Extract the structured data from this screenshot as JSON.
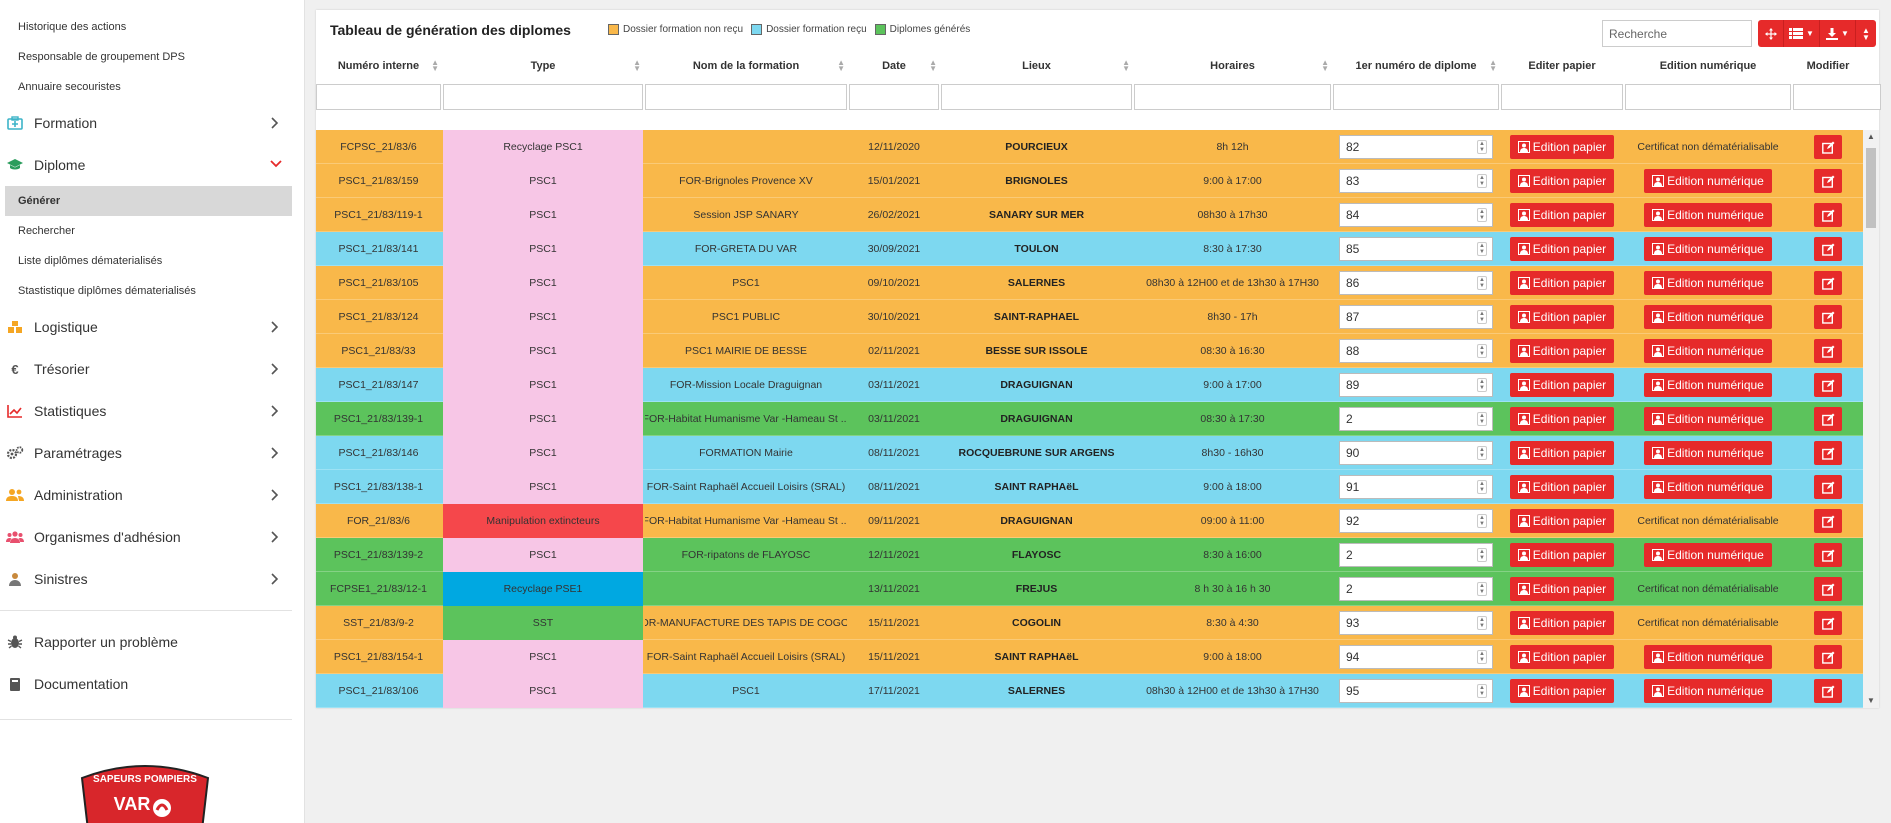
{
  "sidebar": {
    "subitems_top": [
      "Historique des actions",
      "Responsable de groupement DPS",
      "Annuaire secouristes"
    ],
    "menu_formation": {
      "label": "Formation",
      "color": "#3cb4c8"
    },
    "menu_diplome": {
      "label": "Diplome",
      "color": "#2a9d5c"
    },
    "diplome_subitems": [
      "Générer",
      "Rechercher",
      "Liste diplômes dématerialisés",
      "Stastistique diplômes dématerialisés"
    ],
    "menu_items": [
      {
        "label": "Logistique",
        "icon": "cubes-icon",
        "color": "#f5a623"
      },
      {
        "label": "Trésorier",
        "icon": "euro-icon",
        "color": "#555555"
      },
      {
        "label": "Statistiques",
        "icon": "chart-icon",
        "color": "#e62a2a"
      },
      {
        "label": "Paramétrages",
        "icon": "cogs-icon",
        "color": "#555555"
      },
      {
        "label": "Administration",
        "icon": "users-icon",
        "color": "#f5a623"
      },
      {
        "label": "Organismes d'adhésion",
        "icon": "group-icon",
        "color": "#e8506e"
      },
      {
        "label": "Sinistres",
        "icon": "person-icon",
        "color": "#c8893c"
      }
    ],
    "report_problem": "Rapporter un problème",
    "documentation": "Documentation",
    "logo_text_top": "SAPEURS POMPIERS",
    "logo_text_var": "VAR"
  },
  "panel": {
    "title": "Tableau de génération des diplomes",
    "legend": [
      {
        "label": "Dossier formation non reçu",
        "color": "#f9b84a"
      },
      {
        "label": "Dossier formation reçu",
        "color": "#7dd8f0"
      },
      {
        "label": "Diplomes générés",
        "color": "#5cc35c"
      }
    ],
    "search_placeholder": "Recherche"
  },
  "columns": [
    "Numéro interne",
    "Type",
    "Nom de la formation",
    "Date",
    "Lieux",
    "Horaires",
    "1er numéro de diplome",
    "Editer papier",
    "Edition numérique",
    "Modifier"
  ],
  "labels": {
    "edition_papier": "Edition papier",
    "edition_numerique": "Edition numérique",
    "certificat": "Certificat non dématérialisable"
  },
  "colors": {
    "orange": "#f9b84a",
    "blue": "#7dd8f0",
    "green": "#5cc35c",
    "pink": "#f7c6e6",
    "red_type": "#f5474b",
    "blue_type": "#00a8e1",
    "green_type": "#5cc35c",
    "accent": "#e62a2a"
  },
  "rows": [
    {
      "num": "FCPSC_21/83/6",
      "type": "Recyclage PSC1",
      "nom": "",
      "date": "12/11/2020",
      "lieu": "POURCIEUX",
      "horaires": "8h 12h",
      "diplome": "82",
      "status": "orange",
      "type_color": "pink",
      "numerique": false
    },
    {
      "num": "PSC1_21/83/159",
      "type": "PSC1",
      "nom": "FOR-Brignoles Provence XV",
      "date": "15/01/2021",
      "lieu": "BRIGNOLES",
      "horaires": "9:00 à 17:00",
      "diplome": "83",
      "status": "orange",
      "type_color": "pink",
      "numerique": true
    },
    {
      "num": "PSC1_21/83/119-1",
      "type": "PSC1",
      "nom": "Session JSP SANARY",
      "date": "26/02/2021",
      "lieu": "SANARY SUR MER",
      "horaires": "08h30 à 17h30",
      "diplome": "84",
      "status": "orange",
      "type_color": "pink",
      "numerique": true
    },
    {
      "num": "PSC1_21/83/141",
      "type": "PSC1",
      "nom": "FOR-GRETA DU VAR",
      "date": "30/09/2021",
      "lieu": "TOULON",
      "horaires": "8:30 à 17:30",
      "diplome": "85",
      "status": "blue",
      "type_color": "pink",
      "numerique": true
    },
    {
      "num": "PSC1_21/83/105",
      "type": "PSC1",
      "nom": "PSC1",
      "date": "09/10/2021",
      "lieu": "SALERNES",
      "horaires": "08h30 à 12H00 et de 13h30 à 17H30",
      "diplome": "86",
      "status": "orange",
      "type_color": "pink",
      "numerique": true
    },
    {
      "num": "PSC1_21/83/124",
      "type": "PSC1",
      "nom": "PSC1 PUBLIC",
      "date": "30/10/2021",
      "lieu": "SAINT-RAPHAEL",
      "horaires": "8h30 - 17h",
      "diplome": "87",
      "status": "orange",
      "type_color": "pink",
      "numerique": true
    },
    {
      "num": "PSC1_21/83/33",
      "type": "PSC1",
      "nom": "PSC1 MAIRIE DE BESSE",
      "date": "02/11/2021",
      "lieu": "BESSE SUR ISSOLE",
      "horaires": "08:30 à 16:30",
      "diplome": "88",
      "status": "orange",
      "type_color": "pink",
      "numerique": true
    },
    {
      "num": "PSC1_21/83/147",
      "type": "PSC1",
      "nom": "FOR-Mission Locale Draguignan",
      "date": "03/11/2021",
      "lieu": "DRAGUIGNAN",
      "horaires": "9:00 à 17:00",
      "diplome": "89",
      "status": "blue",
      "type_color": "pink",
      "numerique": true
    },
    {
      "num": "PSC1_21/83/139-1",
      "type": "PSC1",
      "nom": "FOR-Habitat Humanisme Var -Hameau St ...",
      "date": "03/11/2021",
      "lieu": "DRAGUIGNAN",
      "horaires": "08:30 à 17:30",
      "diplome": "2",
      "status": "green",
      "type_color": "pink",
      "numerique": true
    },
    {
      "num": "PSC1_21/83/146",
      "type": "PSC1",
      "nom": "FORMATION Mairie",
      "date": "08/11/2021",
      "lieu": "ROCQUEBRUNE SUR ARGENS",
      "horaires": "8h30 - 16h30",
      "diplome": "90",
      "status": "blue",
      "type_color": "pink",
      "numerique": true
    },
    {
      "num": "PSC1_21/83/138-1",
      "type": "PSC1",
      "nom": "FOR-Saint Raphaël Accueil Loisirs (SRAL)",
      "date": "08/11/2021",
      "lieu": "SAINT RAPHAëL",
      "horaires": "9:00 à 18:00",
      "diplome": "91",
      "status": "blue",
      "type_color": "pink",
      "numerique": true
    },
    {
      "num": "FOR_21/83/6",
      "type": "Manipulation extincteurs",
      "nom": "FOR-Habitat Humanisme Var -Hameau St ...",
      "date": "09/11/2021",
      "lieu": "DRAGUIGNAN",
      "horaires": "09:00 à 11:00",
      "diplome": "92",
      "status": "orange",
      "type_color": "red_type",
      "numerique": false
    },
    {
      "num": "PSC1_21/83/139-2",
      "type": "PSC1",
      "nom": "FOR-ripatons de FLAYOSC",
      "date": "12/11/2021",
      "lieu": "FLAYOSC",
      "horaires": "8:30 à 16:00",
      "diplome": "2",
      "status": "green",
      "type_color": "pink",
      "numerique": true
    },
    {
      "num": "FCPSE1_21/83/12-1",
      "type": "Recyclage PSE1",
      "nom": "",
      "date": "13/11/2021",
      "lieu": "FREJUS",
      "horaires": "8 h 30 à 16 h 30",
      "diplome": "2",
      "status": "green",
      "type_color": "blue_type",
      "numerique": false
    },
    {
      "num": "SST_21/83/9-2",
      "type": "SST",
      "nom": "FOR-MANUFACTURE DES TAPIS DE COGO...",
      "date": "15/11/2021",
      "lieu": "COGOLIN",
      "horaires": "8:30 à 4:30",
      "diplome": "93",
      "status": "orange",
      "type_color": "green_type",
      "numerique": false
    },
    {
      "num": "PSC1_21/83/154-1",
      "type": "PSC1",
      "nom": "FOR-Saint Raphaël Accueil Loisirs (SRAL)",
      "date": "15/11/2021",
      "lieu": "SAINT RAPHAëL",
      "horaires": "9:00 à 18:00",
      "diplome": "94",
      "status": "orange",
      "type_color": "pink",
      "numerique": true
    },
    {
      "num": "PSC1_21/83/106",
      "type": "PSC1",
      "nom": "PSC1",
      "date": "17/11/2021",
      "lieu": "SALERNES",
      "horaires": "08h30 à 12H00 et de 13h30 à 17H30",
      "diplome": "95",
      "status": "blue",
      "type_color": "pink",
      "numerique": true
    }
  ]
}
